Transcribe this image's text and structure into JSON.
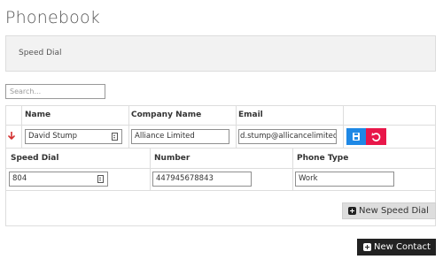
{
  "page": {
    "title": "Phonebook"
  },
  "section": {
    "label": "Speed Dial"
  },
  "search": {
    "placeholder": "Search..."
  },
  "contacts_table": {
    "headers": [
      "Name",
      "Company Name",
      "Email"
    ],
    "row": {
      "name": "David Stump",
      "company": "Alliance Limited",
      "email": "d.stump@allicancelimited"
    }
  },
  "speed_dial_table": {
    "headers": [
      "Speed Dial",
      "Number",
      "Phone Type"
    ],
    "row": {
      "speed_dial": "804",
      "number": "447945678843",
      "phone_type": "Work"
    }
  },
  "buttons": {
    "new_speed_dial": "New Speed Dial",
    "new_contact": "New Contact"
  },
  "icons": {
    "expand": "arrow-down-icon",
    "save": "save-icon",
    "undo": "undo-icon",
    "plus": "plus-square-icon"
  },
  "colors": {
    "save_button": "#1e88e5",
    "undo_button": "#e8174a",
    "expand_arrow": "#d32f2f",
    "new_contact_button": "#222222"
  }
}
